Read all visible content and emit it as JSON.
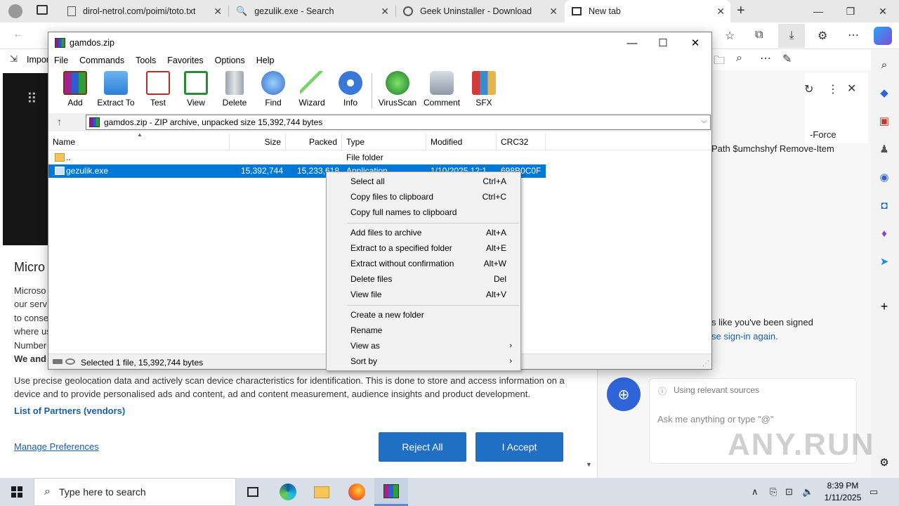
{
  "browser": {
    "tabs": [
      {
        "title": "dirol-netrol.com/poimi/toto.txt"
      },
      {
        "title": "gezulik.exe - Search"
      },
      {
        "title": "Geek Uninstaller - Download"
      },
      {
        "title": "New tab"
      }
    ],
    "favorites_label": "Impor"
  },
  "page": {
    "consent_title": "Micro",
    "consent_lines": [
      "Microso",
      "our serv",
      "to conse",
      "where us",
      "Number"
    ],
    "consent_bold": "We and",
    "consent_para": "Use precise geolocation data and actively scan device characteristics for identification. This is done to store and access information on a device and to provide personalised ads and content, ad and content measurement, audience insights and product development.",
    "partners_link": "List of Partners (vendors)",
    "manage_link": "Manage Preferences",
    "reject_label": "Reject All",
    "accept_label": "I Accept"
  },
  "side": {
    "line1": "-Force",
    "line2": "Path $umchshyf  Remove-Item",
    "line3": "s like you've been signed",
    "line4": "se sign-in again.",
    "sources_label": "Using relevant sources",
    "ask_placeholder": "Ask me anything or type \"@\""
  },
  "rar": {
    "title": "gamdos.zip",
    "menu": [
      "File",
      "Commands",
      "Tools",
      "Favorites",
      "Options",
      "Help"
    ],
    "tools": [
      "Add",
      "Extract To",
      "Test",
      "View",
      "Delete",
      "Find",
      "Wizard",
      "Info",
      "VirusScan",
      "Comment",
      "SFX"
    ],
    "address": "gamdos.zip - ZIP archive, unpacked size 15,392,744 bytes",
    "columns": [
      "Name",
      "Size",
      "Packed",
      "Type",
      "Modified",
      "CRC32"
    ],
    "rows": [
      {
        "name": "..",
        "size": "",
        "packed": "",
        "type": "File folder",
        "modified": "",
        "crc": ""
      },
      {
        "name": "gezulik.exe",
        "size": "15,392,744",
        "packed": "15,233,618",
        "type": "Application",
        "modified": "1/10/2025 12:1",
        "crc": "698B0C0F"
      }
    ],
    "status": "Selected 1 file, 15,392,744 bytes"
  },
  "context_menu": {
    "groups": [
      [
        {
          "label": "Select all",
          "shortcut": "Ctrl+A"
        },
        {
          "label": "Copy files to clipboard",
          "shortcut": "Ctrl+C"
        },
        {
          "label": "Copy full names to clipboard",
          "shortcut": ""
        }
      ],
      [
        {
          "label": "Add files to archive",
          "shortcut": "Alt+A"
        },
        {
          "label": "Extract to a specified folder",
          "shortcut": "Alt+E"
        },
        {
          "label": "Extract without confirmation",
          "shortcut": "Alt+W"
        },
        {
          "label": "Delete files",
          "shortcut": "Del"
        },
        {
          "label": "View file",
          "shortcut": "Alt+V"
        }
      ],
      [
        {
          "label": "Create a new folder",
          "shortcut": ""
        },
        {
          "label": "Rename",
          "shortcut": ""
        },
        {
          "label": "View as",
          "shortcut": "",
          "submenu": true
        },
        {
          "label": "Sort by",
          "shortcut": "",
          "submenu": true
        }
      ]
    ]
  },
  "taskbar": {
    "search_placeholder": "Type here to search",
    "time": "8:39 PM",
    "date": "1/11/2025"
  },
  "watermark": "ANY.RUN",
  "colors": {
    "selection": "#0078d7",
    "accent_button": "#1f6fc5"
  }
}
